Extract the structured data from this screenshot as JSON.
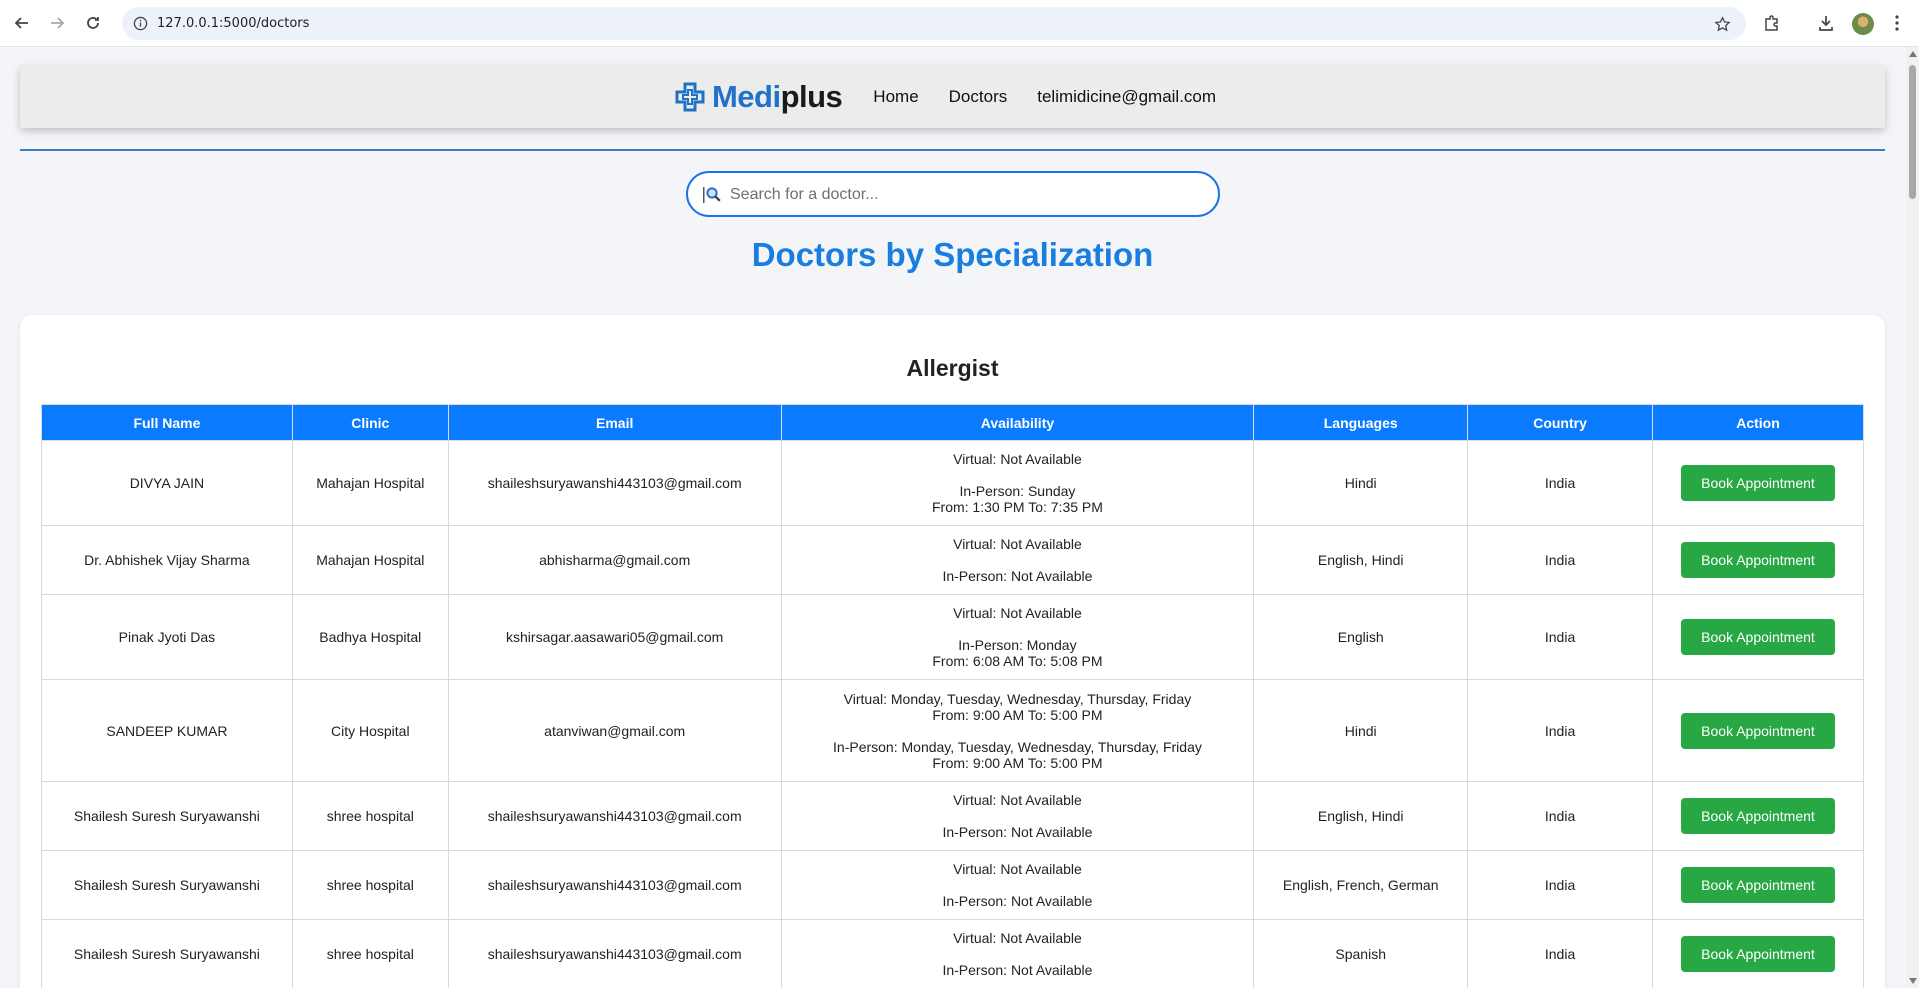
{
  "browser": {
    "url": "127.0.0.1:5000/doctors"
  },
  "nav": {
    "brand_part1": "Medi",
    "brand_part2": "plus",
    "links": [
      "Home",
      "Doctors",
      "telimidicine@gmail.com"
    ]
  },
  "search": {
    "placeholder": "Search for a doctor..."
  },
  "page_title": "Doctors by Specialization",
  "specialization": {
    "title": "Allergist",
    "columns": [
      "Full Name",
      "Clinic",
      "Email",
      "Availability",
      "Languages",
      "Country",
      "Action"
    ],
    "rows": [
      {
        "name": "DIVYA JAIN",
        "clinic": "Mahajan Hospital",
        "email": "shaileshsuryawanshi443103@gmail.com",
        "virtual": [
          "Virtual: Not Available"
        ],
        "in_person": [
          "In-Person: Sunday",
          "From: 1:30 PM To: 7:35 PM"
        ],
        "languages": "Hindi",
        "country": "India",
        "action": "Book Appointment"
      },
      {
        "name": "Dr. Abhishek Vijay Sharma",
        "clinic": "Mahajan Hospital",
        "email": "abhisharma@gmail.com",
        "virtual": [
          "Virtual: Not Available"
        ],
        "in_person": [
          "In-Person: Not Available"
        ],
        "languages": "English, Hindi",
        "country": "India",
        "action": "Book Appointment"
      },
      {
        "name": "Pinak Jyoti Das",
        "clinic": "Badhya Hospital",
        "email": "kshirsagar.aasawari05@gmail.com",
        "virtual": [
          "Virtual: Not Available"
        ],
        "in_person": [
          "In-Person: Monday",
          "From: 6:08 AM To: 5:08 PM"
        ],
        "languages": "English",
        "country": "India",
        "action": "Book Appointment"
      },
      {
        "name": "SANDEEP KUMAR",
        "clinic": "City Hospital",
        "email": "atanviwan@gmail.com",
        "virtual": [
          "Virtual: Monday, Tuesday, Wednesday, Thursday, Friday",
          "From: 9:00 AM To: 5:00 PM"
        ],
        "in_person": [
          "In-Person: Monday, Tuesday, Wednesday, Thursday, Friday",
          "From: 9:00 AM To: 5:00 PM"
        ],
        "languages": "Hindi",
        "country": "India",
        "action": "Book Appointment"
      },
      {
        "name": "Shailesh Suresh Suryawanshi",
        "clinic": "shree hospital",
        "email": "shaileshsuryawanshi443103@gmail.com",
        "virtual": [
          "Virtual: Not Available"
        ],
        "in_person": [
          "In-Person: Not Available"
        ],
        "languages": "English, Hindi",
        "country": "India",
        "action": "Book Appointment"
      },
      {
        "name": "Shailesh Suresh Suryawanshi",
        "clinic": "shree hospital",
        "email": "shaileshsuryawanshi443103@gmail.com",
        "virtual": [
          "Virtual: Not Available"
        ],
        "in_person": [
          "In-Person: Not Available"
        ],
        "languages": "English, French, German",
        "country": "India",
        "action": "Book Appointment"
      },
      {
        "name": "Shailesh Suresh Suryawanshi",
        "clinic": "shree hospital",
        "email": "shaileshsuryawanshi443103@gmail.com",
        "virtual": [
          "Virtual: Not Available"
        ],
        "in_person": [
          "In-Person: Not Available"
        ],
        "languages": "Spanish",
        "country": "India",
        "action": "Book Appointment"
      }
    ]
  },
  "colors": {
    "brand_blue": "#1e73c8",
    "header_blue": "#0a7bff",
    "button_green": "#28a745",
    "title_blue": "#1a7ee0"
  }
}
